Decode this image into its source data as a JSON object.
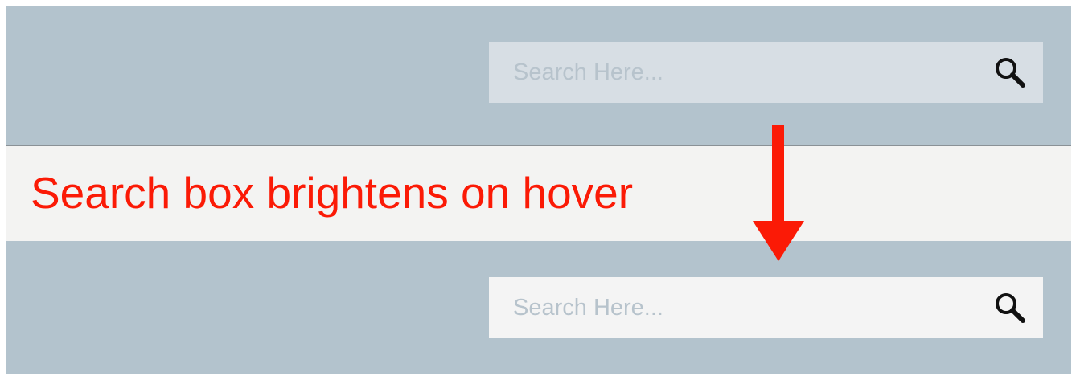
{
  "search_normal": {
    "placeholder": "Search Here...",
    "icon": "magnifier-icon"
  },
  "search_hover": {
    "placeholder": "Search Here...",
    "icon": "magnifier-icon"
  },
  "annotation": {
    "text": "Search box brightens on hover",
    "arrow_icon": "down-arrow-icon"
  },
  "colors": {
    "band": "#b3c3cd",
    "mid_band": "#f3f3f2",
    "search_normal_bg": "#d7dee4",
    "search_hover_bg": "#f4f4f4",
    "placeholder": "#b7c3cc",
    "annotation": "#fb1a06"
  }
}
